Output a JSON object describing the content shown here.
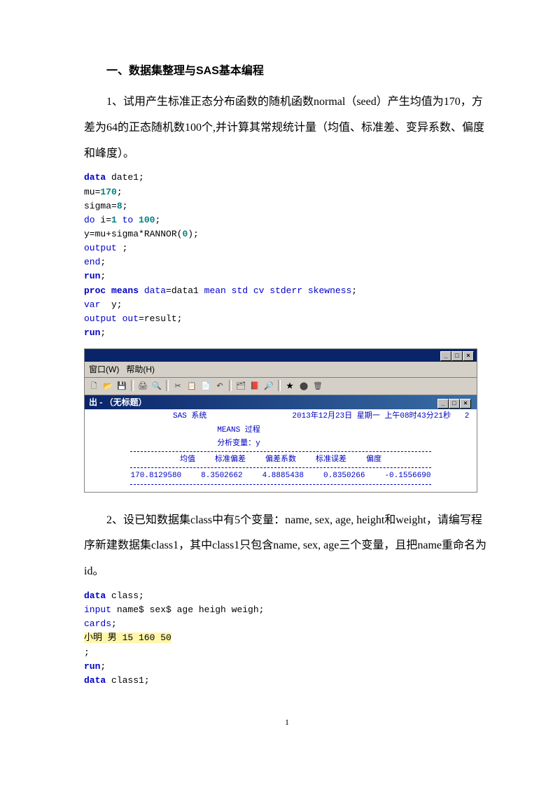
{
  "heading": "一、数据集整理与SAS基本编程",
  "para1": "1、试用产生标准正态分布函数的随机函数normal（seed）产生均值为170，方差为64的正态随机数100个,并计算其常规统计量（均值、标准差、变异系数、偏度和峰度）。",
  "code1": {
    "l1a": "data",
    "l1b": " date1;",
    "l2a": "mu=",
    "l2b": "170",
    "l2c": ";",
    "l3a": "sigma=",
    "l3b": "8",
    "l3c": ";",
    "l4a": "do",
    "l4b": " i=",
    "l4c": "1",
    "l4d": " to ",
    "l4e": "100",
    "l4f": ";",
    "l5a": "y=mu+sigma*RANNOR(",
    "l5b": "0",
    "l5c": ");",
    "l6a": "output",
    "l6b": " ;",
    "l7a": "end",
    "l7b": ";",
    "l8a": "run",
    "l8b": ";",
    "l9a": "proc",
    "l9b": " means",
    "l9c": " data",
    "l9d": "=data1 ",
    "l9e": "mean std cv stderr skewness",
    "l9f": ";",
    "l10a": "var",
    "l10b": "  y;",
    "l11a": "output",
    "l11b": " out",
    "l11c": "=result;",
    "l12a": "run",
    "l12b": ";"
  },
  "sas_window": {
    "menu_window": "窗口(W)",
    "menu_help": "帮助(H)",
    "sub_title": "出 - （无标题）",
    "sys_label": "SAS 系统",
    "timestamp": "2013年12月23日 星期一 上午08时43分21秒",
    "runnum": "2",
    "proc_label": "MEANS 过程",
    "anal_label": "分析变量：y",
    "hdr_mean": "均值",
    "hdr_std": "标准偏差",
    "hdr_cv": "偏差系数",
    "hdr_se": "标准误差",
    "hdr_skew": "偏度",
    "val_mean": "170.8129580",
    "val_std": "8.3502662",
    "val_cv": "4.8885438",
    "val_se": "0.8350266",
    "val_skew": "-0.1556690"
  },
  "para2": "2、设已知数据集class中有5个变量：name, sex, age, height和weight，请编写程序新建数据集class1，其中class1只包含name, sex, age三个变量，且把name重命名为id。",
  "code2": {
    "l1a": "data",
    "l1b": " class;",
    "l2a": "input",
    "l2b": " name$ sex$ age heigh weigh;",
    "l3a": "cards",
    "l3b": ";",
    "l4": "小明 男 15 160 50",
    "l5": ";",
    "l6a": "run",
    "l6b": ";",
    "l7a": "data",
    "l7b": " class1;"
  },
  "pagenum": "1"
}
